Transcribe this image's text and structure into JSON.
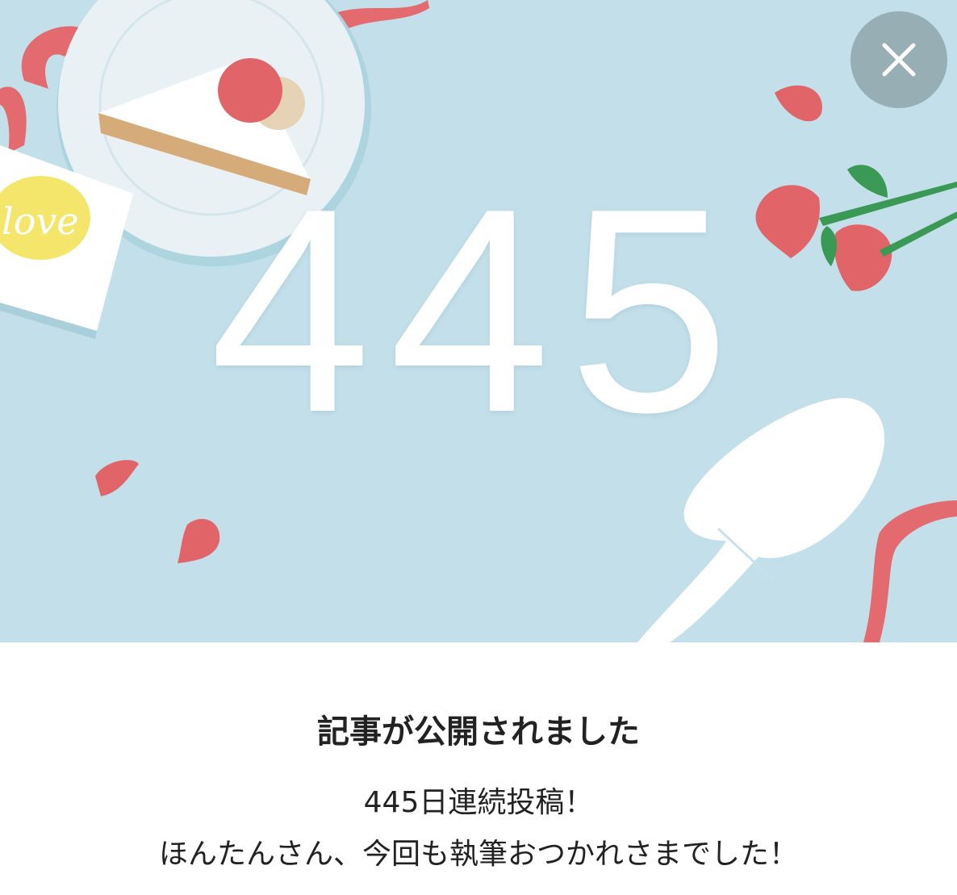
{
  "hero": {
    "count": "445",
    "card_text": "love",
    "colors": {
      "background": "#c3e0ea",
      "petal": "#e06468",
      "ribbon": "#e36a6f",
      "card_badge": "#f4e66a",
      "plate": "#e9f1f5"
    }
  },
  "close_button": {
    "icon": "close-icon",
    "color": "#98aeb5"
  },
  "dialog": {
    "title": "記事が公開されました",
    "message_line1": "445日連続投稿！",
    "message_line2": "ほんたんさん、今回も執筆おつかれさまでした！"
  }
}
